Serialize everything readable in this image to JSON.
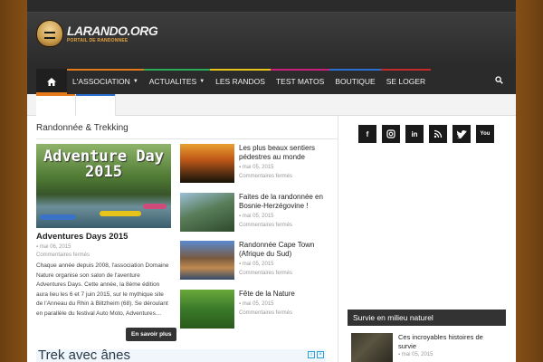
{
  "brand": {
    "name": "LARANDO.ORG",
    "tagline": "PORTAIL DE RANDONNEE"
  },
  "nav": {
    "items": [
      {
        "label": "L'ASSOCIATION",
        "dropdown": true,
        "color": "#e57a1a"
      },
      {
        "label": "ACTUALITES",
        "dropdown": true,
        "color": "#2bab5a"
      },
      {
        "label": "LES RANDOS",
        "dropdown": false,
        "color": "#e8c41a"
      },
      {
        "label": "TEST MATOS",
        "dropdown": false,
        "color": "#c8207a"
      },
      {
        "label": "BOUTIQUE",
        "dropdown": false,
        "color": "#2a6fd0"
      },
      {
        "label": "SE LOGER",
        "dropdown": false,
        "color": "#c52a2a"
      }
    ],
    "home_icon": "home-icon",
    "search_icon": "search-icon",
    "accent": "#e57a1a"
  },
  "section": {
    "title": "Randonnée & Trekking",
    "featured": {
      "image_overlay": "Adventure Day 2015",
      "title": "Adventures Days 2015",
      "date": "mai 06, 2015",
      "comments": "Commentaires fermés",
      "excerpt": "Chaque année depuis 2008, l'association Domaine Nature organise son salon de l'aventure Adventures Days. Cette année, la 8ème édition aura lieu les 6 et 7 juin 2015, sur le mythique site de l'Anneau du Rhin à Biltzheim (68). Se déroulant en parallèle du festival Auto Moto, Adventures…",
      "more_label": "En savoir plus"
    },
    "list": [
      {
        "title": "Les plus beaux sentiers pédestres au monde",
        "date": "mai 05, 2015",
        "comments": "Commentaires fermés"
      },
      {
        "title": "Faites de la randonnée en Bosnie-Herzégovine !",
        "date": "mai 05, 2015",
        "comments": "Commentaires fermés"
      },
      {
        "title": "Randonnée Cape Town (Afrique du Sud)",
        "date": "mai 05, 2015",
        "comments": "Commentaires fermés"
      },
      {
        "title": "Fête de la Nature",
        "date": "mai 05, 2015",
        "comments": "Commentaires fermés"
      }
    ]
  },
  "ad": {
    "text": "Trek avec ânes"
  },
  "social": [
    "f",
    "ig",
    "in",
    "rss",
    "tw",
    "yt"
  ],
  "sidebar": {
    "title": "Survie en milieu naturel",
    "item": {
      "title": "Ces incroyables histoires de survie",
      "date": "mai 05, 2015"
    }
  }
}
